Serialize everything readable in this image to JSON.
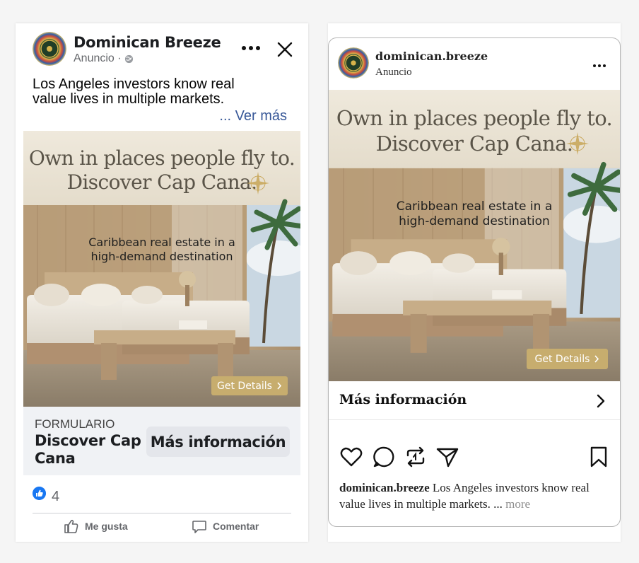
{
  "colors": {
    "fb_blue": "#1877f2",
    "fb_link": "#385898",
    "gold": "#c7ad6e"
  },
  "facebook": {
    "page_name": "Dominican Breeze",
    "sponsored": "Anuncio ·",
    "caption": "Los Angeles investors know real value lives in multiple markets.",
    "see_more": "... Ver más",
    "icons": [
      "more-icon",
      "close-icon",
      "globe-icon",
      "like-icon",
      "comment-icon"
    ],
    "creative": {
      "headline_line1": "Own in places people fly to.",
      "headline_line2": "Discover Cap Cana.",
      "subhead_line1": "Caribbean real estate in a",
      "subhead_line2": "high-demand destination",
      "button": "Get Details"
    },
    "form_label": "FORMULARIO",
    "form_title": "Discover Cap Cana",
    "cta": "Más información",
    "like_count": "4",
    "actions": {
      "like": "Me gusta",
      "comment": "Comentar"
    }
  },
  "instagram": {
    "username": "dominican.breeze",
    "sponsored": "Anuncio",
    "creative": {
      "headline_line1": "Own in places people fly to.",
      "headline_line2": "Discover Cap Cana.",
      "subhead_line1": "Caribbean real estate in a",
      "subhead_line2": "high-demand destination",
      "button": "Get Details"
    },
    "cta": "Más información",
    "icons": [
      "heart-icon",
      "comment-icon",
      "repost-icon",
      "share-icon",
      "bookmark-icon"
    ],
    "caption_user": "dominican.breeze",
    "caption_text": " Los Angeles investors know real value lives in multiple markets. ...",
    "caption_more": " more"
  }
}
